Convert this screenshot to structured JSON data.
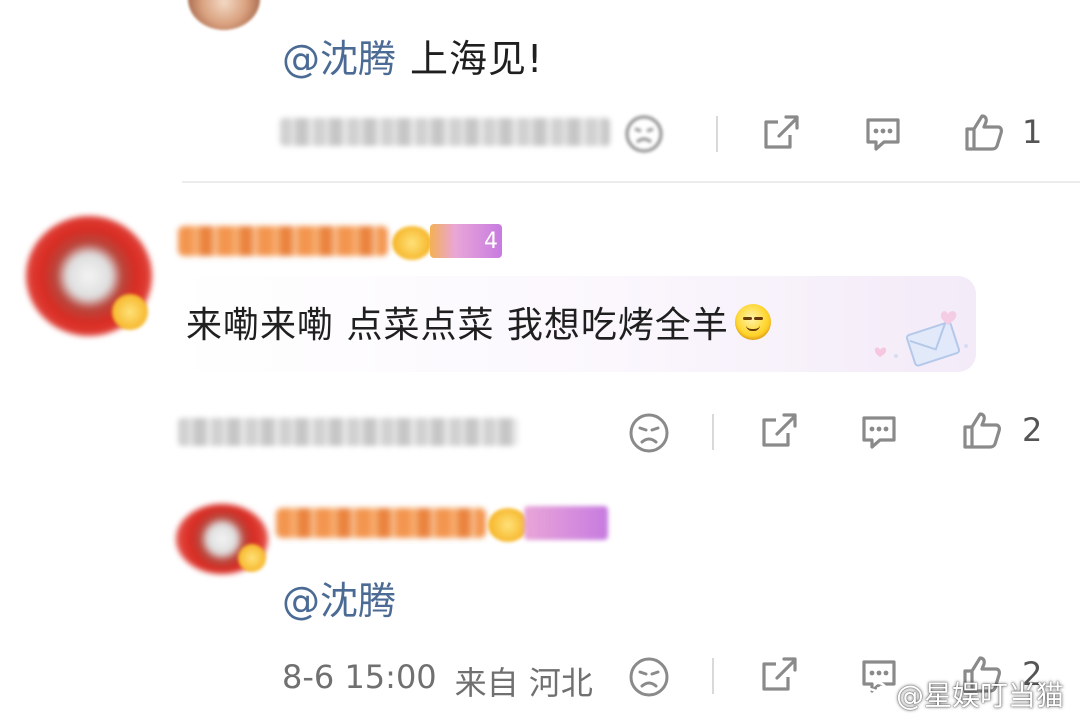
{
  "comment_1": {
    "mention": "@沈腾",
    "text": "上海见!",
    "like_count": "1"
  },
  "comment_2": {
    "level": "4",
    "text": "来嘞来嘞 点菜点菜 我想吃烤全羊",
    "emoji": "smiling-face-emoji",
    "like_count": "2"
  },
  "reply_1": {
    "mention": "@沈腾",
    "date": "8-6 15:00",
    "source": "来自 河北",
    "like_count": "2"
  },
  "watermark": {
    "text": "@星娱叮当猫"
  },
  "icons": [
    "angry-face-icon",
    "share-icon",
    "comment-icon",
    "like-icon",
    "weibo-icon"
  ],
  "colors": {
    "mention": "#4b6a94",
    "icon": "#8a8a8a",
    "username_blur": "#f28a3c"
  }
}
